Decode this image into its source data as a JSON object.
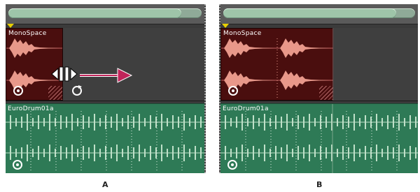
{
  "panels": [
    {
      "id": "A",
      "caption": "A",
      "tracks": [
        {
          "clip_label": "MonoSpace"
        },
        {
          "clip_label": "EuroDrum01a"
        }
      ]
    },
    {
      "id": "B",
      "caption": "B",
      "tracks": [
        {
          "clip_label": "MonoSpace"
        },
        {
          "clip_label": "EuroDrum01a"
        }
      ]
    }
  ],
  "colors": {
    "mono_clip": "#4a0e0e",
    "mono_wave": "#e8988a",
    "drum_clip": "#2e7a56",
    "drum_wave": "#bfe0c8",
    "arrow": "#c0245a",
    "playhead": "#e8d000"
  },
  "icons": [
    "loop-icon",
    "resize-cursor-icon",
    "drag-arrow-icon",
    "loop-cursor-icon"
  ]
}
